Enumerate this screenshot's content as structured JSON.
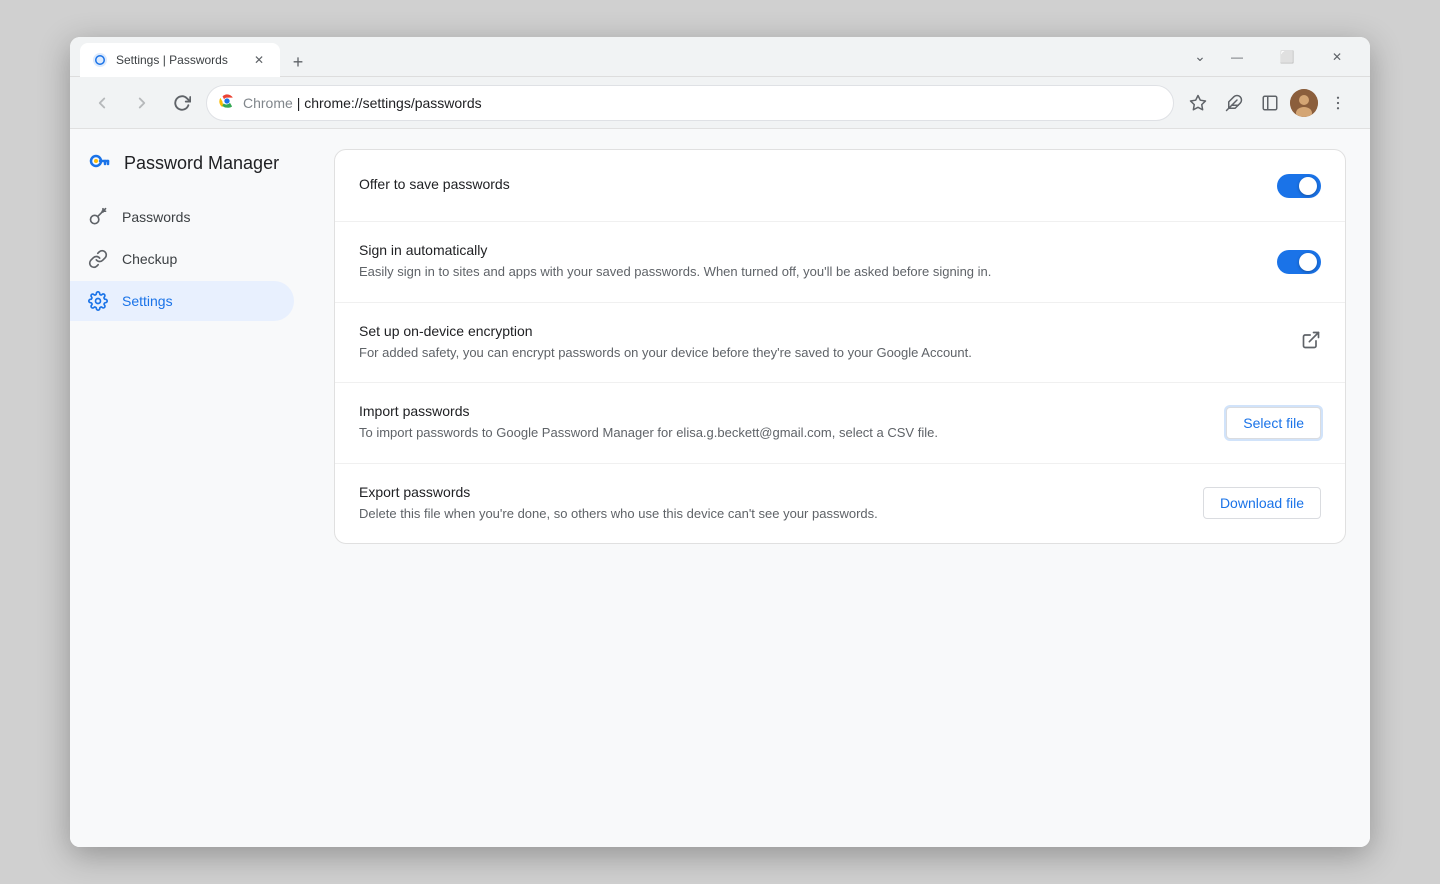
{
  "browser": {
    "tab": {
      "title": "Settings | Passwords",
      "favicon": "⚙"
    },
    "new_tab_label": "+",
    "address": {
      "protocol_label": "Chrome",
      "url_display": "chrome://settings/passwords",
      "url_full": "chrome://settings/passwords"
    },
    "window_controls": {
      "minimize": "—",
      "maximize": "□",
      "close": "✕"
    },
    "title_bar_buttons": {
      "chevron_down": "⌄",
      "minimize": "—",
      "maximize": "⬜",
      "close": "✕"
    }
  },
  "sidebar": {
    "title": "Password Manager",
    "items": [
      {
        "id": "passwords",
        "label": "Passwords",
        "icon": "key"
      },
      {
        "id": "checkup",
        "label": "Checkup",
        "icon": "checkup"
      },
      {
        "id": "settings",
        "label": "Settings",
        "icon": "gear",
        "active": true
      }
    ]
  },
  "settings": {
    "rows": [
      {
        "id": "offer-save",
        "title": "Offer to save passwords",
        "desc": "",
        "action_type": "toggle",
        "toggle_on": true
      },
      {
        "id": "auto-signin",
        "title": "Sign in automatically",
        "desc": "Easily sign in to sites and apps with your saved passwords. When turned off, you'll be asked before signing in.",
        "action_type": "toggle",
        "toggle_on": true
      },
      {
        "id": "encryption",
        "title": "Set up on-device encryption",
        "desc": "For added safety, you can encrypt passwords on your device before they're saved to your Google Account.",
        "action_type": "external-link"
      },
      {
        "id": "import",
        "title": "Import passwords",
        "desc": "To import passwords to Google Password Manager for elisa.g.beckett@gmail.com, select a CSV file.",
        "action_type": "button",
        "button_label": "Select file"
      },
      {
        "id": "export",
        "title": "Export passwords",
        "desc": "Delete this file when you're done, so others who use this device can't see your passwords.",
        "action_type": "button",
        "button_label": "Download file"
      }
    ]
  },
  "colors": {
    "accent": "#1a73e8",
    "active_nav_bg": "#e8f0fe",
    "toggle_on": "#1a73e8",
    "toggle_off": "#dadce0"
  },
  "icons": {
    "key": "🔑",
    "checkup": "🔗",
    "gear": "⚙",
    "star": "☆",
    "puzzle": "🧩",
    "sidebar_toggle": "⬛",
    "more": "⋮",
    "back": "←",
    "forward": "→",
    "refresh": "↻"
  }
}
